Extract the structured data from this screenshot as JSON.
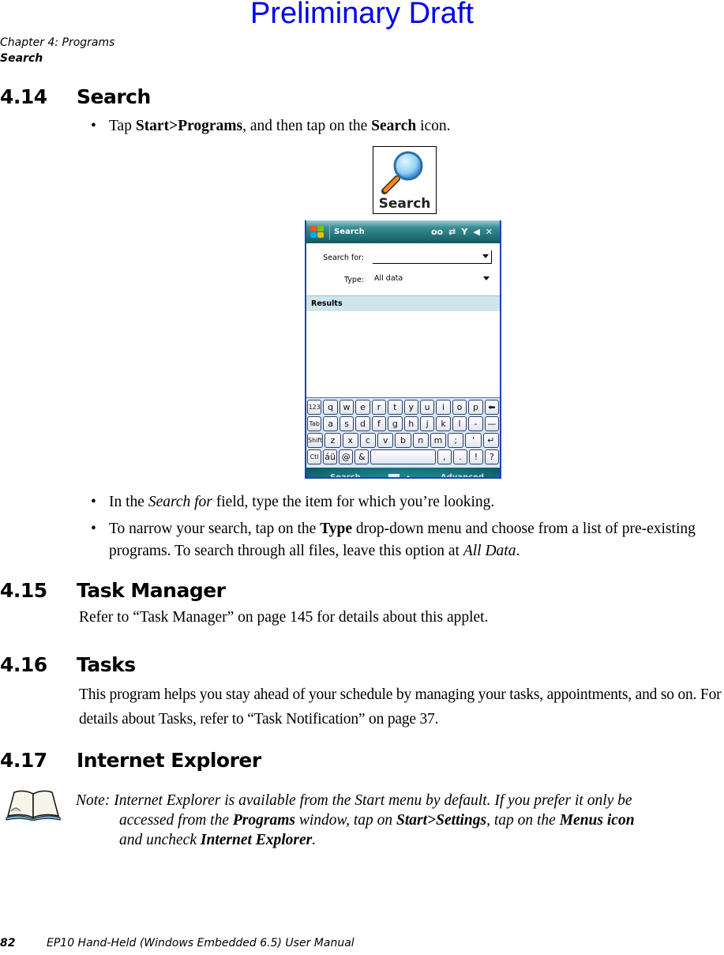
{
  "watermark": "Preliminary Draft",
  "running_header": {
    "chapter": "Chapter 4:  Programs",
    "section": "Search"
  },
  "sections": [
    {
      "number": "4.14",
      "title": "Search"
    },
    {
      "number": "4.15",
      "title": "Task Manager"
    },
    {
      "number": "4.16",
      "title": "Tasks"
    },
    {
      "number": "4.17",
      "title": "Internet Explorer"
    }
  ],
  "search_section": {
    "bullet1": {
      "pre": "Tap ",
      "b1": "Start>Programs",
      "mid": ", and then tap on the ",
      "b2": "Search",
      "post": " icon."
    },
    "bullet2": {
      "pre": "In the ",
      "i1": "Search for",
      "post": " field, type the item for which you’re looking."
    },
    "bullet3": {
      "pre": "To narrow your search, tap on the ",
      "b1": "Type",
      "mid": " drop-down menu and choose from a list of pre-existing programs. To search through all files, leave this option at ",
      "i1": "All Data",
      "post": "."
    }
  },
  "search_icon_label": "Search",
  "device": {
    "title": "Search",
    "status_icons": [
      "voicemail-icon",
      "sync-icon",
      "signal-icon",
      "speaker-icon",
      "close-icon"
    ],
    "search_for_label": "Search for:",
    "search_for_value": "",
    "type_label": "Type:",
    "type_value": "All data",
    "results_label": "Results",
    "keyboard": [
      [
        "123",
        "q",
        "w",
        "e",
        "r",
        "t",
        "y",
        "u",
        "i",
        "o",
        "p",
        "⬅"
      ],
      [
        "Tab",
        "a",
        "s",
        "d",
        "f",
        "g",
        "h",
        "j",
        "k",
        "l",
        "-",
        "—"
      ],
      [
        "Shift",
        "z",
        "x",
        "c",
        "v",
        "b",
        "n",
        "m",
        ";",
        "'",
        "↵"
      ],
      [
        "Ctl",
        "áü",
        "@",
        "&",
        " ",
        ",",
        ".",
        "!",
        "?"
      ]
    ],
    "softkey_left": "Search",
    "softkey_right": "Advanced"
  },
  "task_manager_text": "Refer to “Task Manager” on page 145 for details about this applet.",
  "tasks_text": "This program helps you stay ahead of your schedule by managing your tasks, appointments, and so on. For details about Tasks, refer to “Task Notification” on page 37.",
  "note": {
    "p1": "Note: Internet Explorer is available from the Start menu by default. If you prefer it only be",
    "p2a": "accessed from the ",
    "p2b": "Programs",
    "p2c": " window, tap on ",
    "p2d": "Start>Settings",
    "p2e": ", tap on the ",
    "p2f": "Menus icon",
    "p3a": "and uncheck ",
    "p3b": "Internet Explorer",
    "p3c": "."
  },
  "footer": {
    "page": "82",
    "title": "EP10 Hand-Held (Windows Embedded 6.5) User Manual"
  }
}
